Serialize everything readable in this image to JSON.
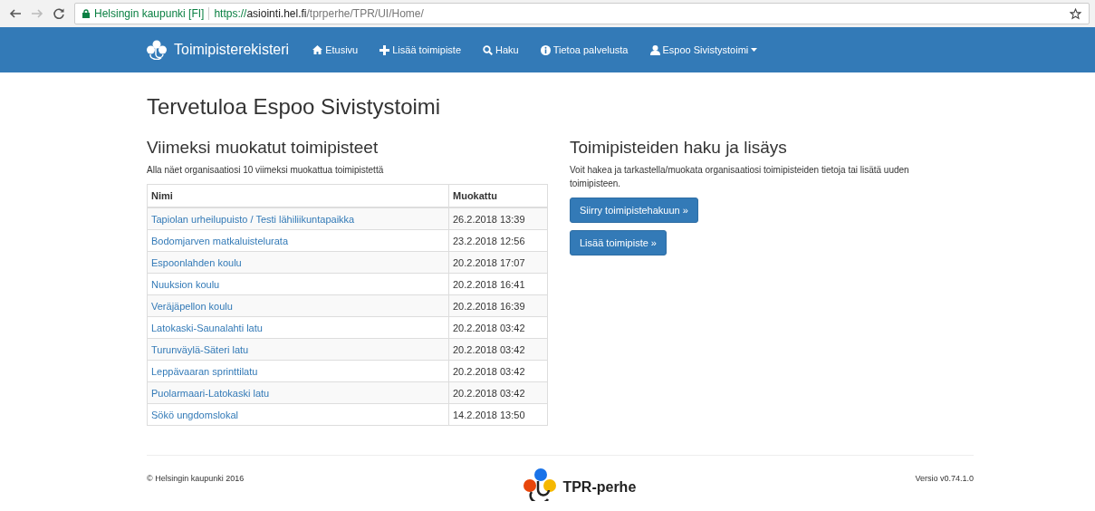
{
  "browser": {
    "site_name": "Helsingin kaupunki [FI]",
    "url_scheme": "https://",
    "url_host": "asiointi.hel.fi",
    "url_path": "/tprperhe/TPR/UI/Home/"
  },
  "navbar": {
    "brand": "Toimipisterekisteri",
    "items": [
      {
        "label": "Etusivu",
        "kind": "home"
      },
      {
        "label": "Lisää toimipiste",
        "kind": "add"
      },
      {
        "label": "Haku",
        "kind": "search"
      },
      {
        "label": "Tietoa palvelusta",
        "kind": "info"
      },
      {
        "label": "Espoo Sivistystoimi",
        "kind": "account",
        "dropdown": true
      }
    ]
  },
  "page_title": "Tervetuloa Espoo Sivistystoimi",
  "recent": {
    "heading": "Viimeksi muokatut toimipisteet",
    "description": "Alla näet organisaatiosi 10 viimeksi muokattua toimipistettä",
    "columns": [
      "Nimi",
      "Muokattu"
    ],
    "rows": [
      [
        "Tapiolan urheilupuisto / Testi lähiliikuntapaikka",
        "26.2.2018 13:39"
      ],
      [
        "Bodomjarven matkaluistelurata",
        "23.2.2018 12:56"
      ],
      [
        "Espoonlahden koulu",
        "20.2.2018 17:07"
      ],
      [
        "Nuuksion koulu",
        "20.2.2018 16:41"
      ],
      [
        "Veräjäpellon koulu",
        "20.2.2018 16:39"
      ],
      [
        "Latokaski-Saunalahti latu",
        "20.2.2018 03:42"
      ],
      [
        "Turunväylä-Säteri latu",
        "20.2.2018 03:42"
      ],
      [
        "Leppävaaran sprinttilatu",
        "20.2.2018 03:42"
      ],
      [
        "Puolarmaari-Latokaski latu",
        "20.2.2018 03:42"
      ],
      [
        "Sökö ungdomslokal",
        "14.2.2018 13:50"
      ]
    ]
  },
  "search_add": {
    "heading": "Toimipisteiden haku ja lisäys",
    "description": "Voit hakea ja tarkastella/muokata organisaatiosi toimipisteiden tietoja tai lisätä uuden toimipisteen.",
    "buttons": [
      "Siirry toimipistehakuun »",
      "Lisää toimipiste »"
    ]
  },
  "footer": {
    "copyright": "© Helsingin kaupunki 2016",
    "logo_text": "TPR-perhe",
    "version": "Versio v0.74.1.0"
  }
}
